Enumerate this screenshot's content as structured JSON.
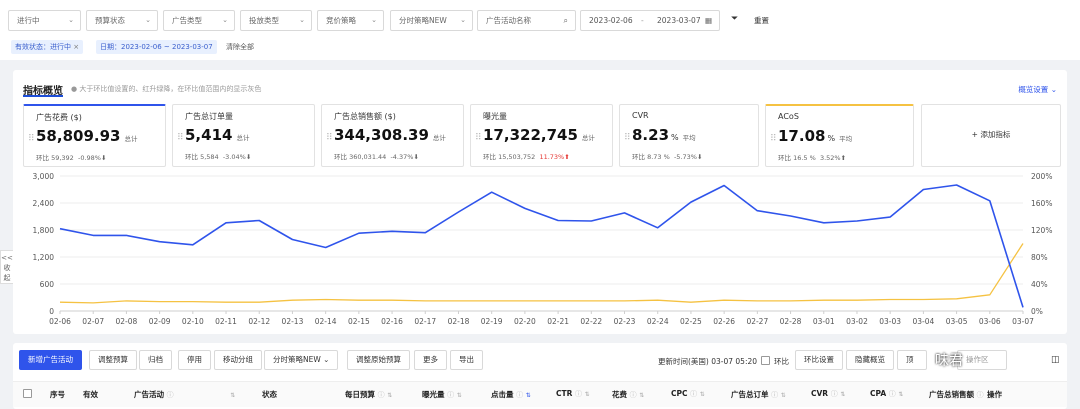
{
  "filters": {
    "status": "进行中",
    "budget_status": "预算状态",
    "ad_type": "广告类型",
    "delivery_type": "投放类型",
    "bid_strategy": "竞价策略",
    "dayparting": "分时策略NEW",
    "campaign_name_placeholder": "广告活动名称",
    "date_start": "2023-02-06",
    "date_sep": "-",
    "date_end": "2023-03-07",
    "reset": "重置",
    "tags": [
      {
        "label": "有效状态：进行中",
        "close": "×"
      },
      {
        "label": "日期：2023-02-06 ~ 2023-03-07"
      }
    ],
    "clear_all": "清除全部"
  },
  "overview": {
    "title": "指标概览",
    "hint": "● 大于环比值设置的、红升绿降，在环比值范围内的显示灰色",
    "settings": "概览设置",
    "add_metric": "+ 添加指标",
    "cards": [
      {
        "title": "广告花费 ($)",
        "value": "58,809.93",
        "unit": "",
        "summary": "总计",
        "cmp_label": "环比",
        "cmp_value": "59,392",
        "cmp_pct": "-0.98%",
        "arrow": "⬇"
      },
      {
        "title": "广告总订单量",
        "value": "5,414",
        "unit": "",
        "summary": "总计",
        "cmp_label": "环比",
        "cmp_value": "5,584",
        "cmp_pct": "-3.04%",
        "arrow": "⬇"
      },
      {
        "title": "广告总销售额 ($)",
        "value": "344,308.39",
        "unit": "",
        "summary": "总计",
        "cmp_label": "环比",
        "cmp_value": "360,031.44",
        "cmp_pct": "-4.37%",
        "arrow": "⬇"
      },
      {
        "title": "曝光量",
        "value": "17,322,745",
        "unit": "",
        "summary": "总计",
        "cmp_label": "环比",
        "cmp_value": "15,503,752",
        "cmp_pct": "11.73%",
        "arrow": "⬆"
      },
      {
        "title": "CVR",
        "value": "8.23",
        "unit": "%",
        "summary": "平均",
        "cmp_label": "环比",
        "cmp_value": "8.73 %",
        "cmp_pct": "-5.73%",
        "arrow": "⬇"
      },
      {
        "title": "ACoS",
        "value": "17.08",
        "unit": "%",
        "summary": "平均",
        "cmp_label": "环比",
        "cmp_value": "16.5 %",
        "cmp_pct": "3.52%",
        "arrow": "⬆"
      }
    ]
  },
  "side_tab": "<< 收起",
  "chart_data": {
    "type": "line",
    "x": [
      "02-06",
      "02-07",
      "02-08",
      "02-09",
      "02-10",
      "02-11",
      "02-12",
      "02-13",
      "02-14",
      "02-15",
      "02-16",
      "02-17",
      "02-18",
      "02-19",
      "02-20",
      "02-21",
      "02-22",
      "02-23",
      "02-24",
      "02-25",
      "02-26",
      "02-27",
      "02-28",
      "03-01",
      "03-02",
      "03-03",
      "03-04",
      "03-05",
      "03-06",
      "03-07"
    ],
    "y_left_ticks": [
      "0",
      "600",
      "1,200",
      "1,800",
      "2,400",
      "3,000"
    ],
    "y_right_ticks": [
      "0%",
      "40%",
      "80%",
      "120%",
      "160%",
      "200%"
    ],
    "ylim_left": [
      0,
      3000
    ],
    "ylim_right": [
      0,
      200
    ],
    "grid": true,
    "series": [
      {
        "axis": "left",
        "color": "#2f54eb",
        "values": [
          1830,
          1680,
          1680,
          1540,
          1470,
          1960,
          2010,
          1590,
          1410,
          1730,
          1770,
          1740,
          2200,
          2640,
          2280,
          2010,
          2000,
          2180,
          1850,
          2420,
          2790,
          2230,
          2110,
          1960,
          2000,
          2090,
          2700,
          2800,
          2450,
          80
        ]
      },
      {
        "axis": "right",
        "color": "#f5c242",
        "values": [
          13,
          12,
          15,
          14,
          14,
          13,
          13,
          16,
          17,
          16,
          16,
          15,
          15,
          15,
          15,
          15,
          15,
          15,
          16,
          13,
          16,
          15,
          15,
          16,
          16,
          17,
          17,
          18,
          24,
          100
        ]
      }
    ]
  },
  "toolbar": {
    "new_campaign": "新增广告活动",
    "adjust_budget": "调整预算",
    "archive": "归档",
    "pause": "停用",
    "move_group": "移动分组",
    "dayparting": "分时策略NEW",
    "adjust_original_budget": "调整原始预算",
    "more": "更多",
    "export": "导出",
    "update_time": "更新时间(美国) 03-07 05:20",
    "mom_label": "环比",
    "mom_settings": "环比设置",
    "hide_overview": "隐藏概览",
    "partial": "顶",
    "partial2": "操作区",
    "watermark": "味君"
  },
  "table": {
    "headers": {
      "index": "序号",
      "valid": "有效",
      "campaign": "广告活动",
      "status": "状态",
      "daily_budget": "每日预算",
      "impressions": "曝光量",
      "clicks": "点击量",
      "ctr": "CTR",
      "spend": "花费",
      "cpc": "CPC",
      "total_orders": "广告总订单",
      "cvr": "CVR",
      "cpa": "CPA",
      "total_sales": "广告总销售额",
      "actions": "操作"
    }
  }
}
